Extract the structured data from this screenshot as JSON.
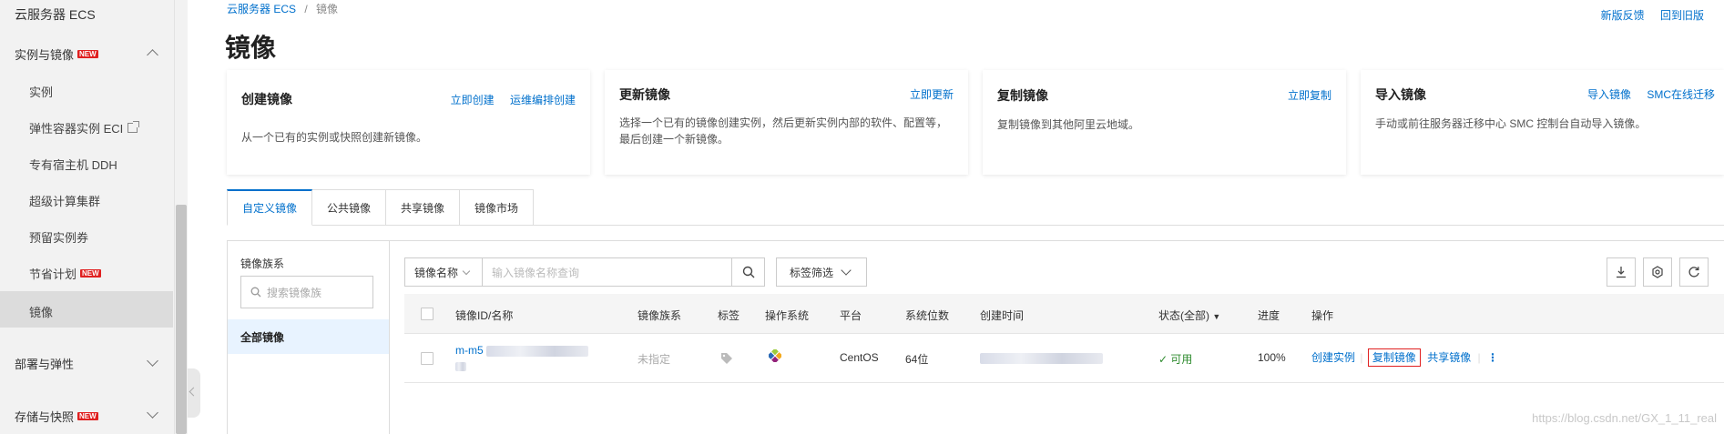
{
  "sidebar": {
    "title": "云服务器 ECS",
    "groups": [
      {
        "label": "实例与镜像",
        "badge": "NEW"
      },
      {
        "label": "部署与弹性"
      },
      {
        "label": "存储与快照",
        "badge": "NEW"
      }
    ],
    "items": [
      {
        "label": "实例"
      },
      {
        "label": "弹性容器实例 ECI"
      },
      {
        "label": "专有宿主机 DDH"
      },
      {
        "label": "超级计算集群"
      },
      {
        "label": "预留实例券"
      },
      {
        "label": "节省计划",
        "badge": "NEW"
      },
      {
        "label": "镜像"
      }
    ]
  },
  "breadcrumb": {
    "root": "云服务器 ECS",
    "sep": "/",
    "current": "镜像"
  },
  "top_links": [
    "新版反馈",
    "回到旧版"
  ],
  "page_title": "镜像",
  "cards": [
    {
      "title": "创建镜像",
      "links": [
        "立即创建",
        "运维编排创建"
      ],
      "desc": "从一个已有的实例或快照创建新镜像。"
    },
    {
      "title": "更新镜像",
      "links": [
        "立即更新"
      ],
      "desc": "选择一个已有的镜像创建实例，然后更新实例内部的软件、配置等，最后创建一个新镜像。"
    },
    {
      "title": "复制镜像",
      "links": [
        "立即复制"
      ],
      "desc": "复制镜像到其他阿里云地域。"
    },
    {
      "title": "导入镜像",
      "links": [
        "导入镜像",
        "SMC在线迁移"
      ],
      "desc": "手动或前往服务器迁移中心 SMC 控制台自动导入镜像。"
    }
  ],
  "tabs": [
    "自定义镜像",
    "公共镜像",
    "共享镜像",
    "镜像市场"
  ],
  "family_panel": {
    "label": "镜像族系",
    "search_placeholder": "搜索镜像族",
    "all_label": "全部镜像"
  },
  "filter": {
    "select_value": "镜像名称",
    "input_placeholder": "输入镜像名称查询",
    "tag_filter": "标签筛选"
  },
  "table": {
    "headers": [
      "镜像ID/名称",
      "镜像族系",
      "标签",
      "操作系统",
      "平台",
      "系统位数",
      "创建时间",
      "状态(全部)",
      "进度",
      "操作"
    ],
    "rows": [
      {
        "id_prefix": "m-m5",
        "family": "未指定",
        "platform": "CentOS",
        "bits": "64位",
        "status": "可用",
        "progress": "100%",
        "actions": [
          "创建实例",
          "复制镜像",
          "共享镜像"
        ]
      }
    ]
  },
  "watermark": "https://blog.csdn.net/GX_1_11_real"
}
